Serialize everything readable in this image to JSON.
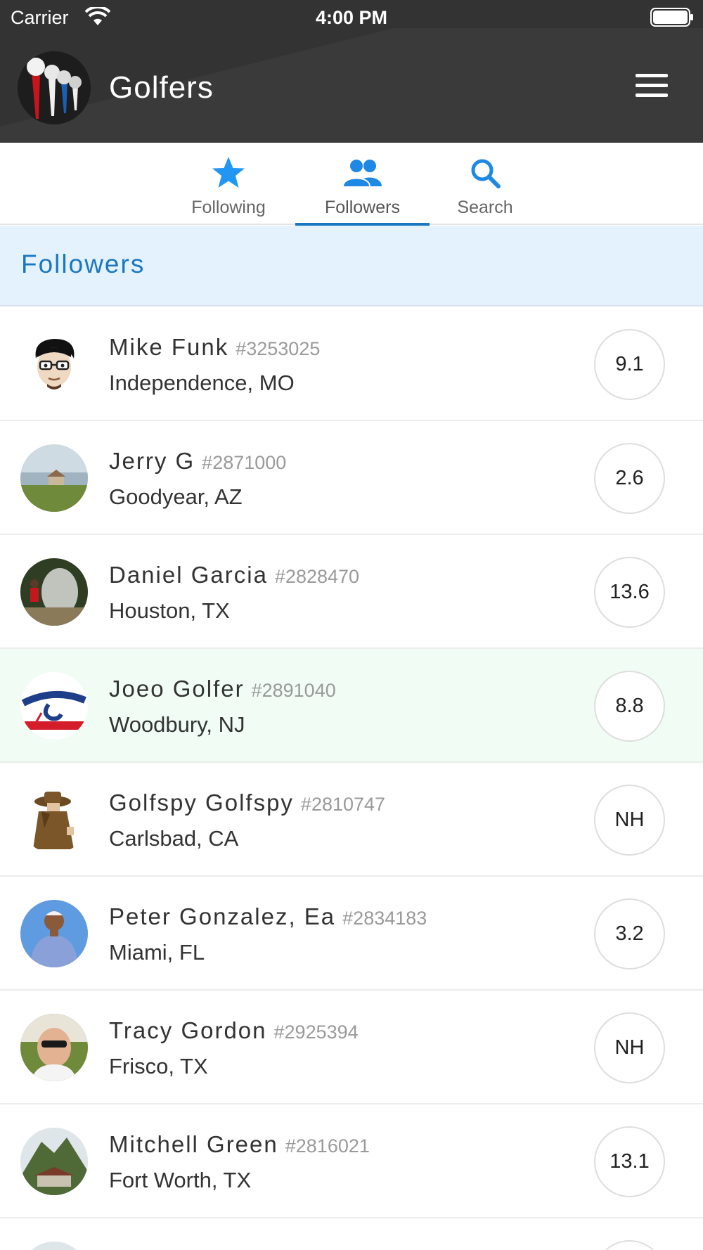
{
  "status_bar": {
    "carrier": "Carrier",
    "time": "4:00 PM"
  },
  "header": {
    "title": "Golfers"
  },
  "tabs": [
    {
      "label": "Following",
      "icon": "star-icon"
    },
    {
      "label": "Followers",
      "icon": "people-icon",
      "active": true
    },
    {
      "label": "Search",
      "icon": "search-icon"
    }
  ],
  "section": {
    "title": "Followers"
  },
  "followers": [
    {
      "name": "Mike Funk",
      "id": "#3253025",
      "location": "Independence, MO",
      "handicap": "9.1"
    },
    {
      "name": "Jerry G",
      "id": "#2871000",
      "location": "Goodyear, AZ",
      "handicap": "2.6"
    },
    {
      "name": "Daniel Garcia",
      "id": "#2828470",
      "location": "Houston, TX",
      "handicap": "13.6"
    },
    {
      "name": "Joeo Golfer",
      "id": "#2891040",
      "location": "Woodbury, NJ",
      "handicap": "8.8"
    },
    {
      "name": "Golfspy Golfspy",
      "id": "#2810747",
      "location": "Carlsbad, CA",
      "handicap": "NH"
    },
    {
      "name": "Peter Gonzalez, Ea",
      "id": "#2834183",
      "location": "Miami, FL",
      "handicap": "3.2"
    },
    {
      "name": "Tracy Gordon",
      "id": "#2925394",
      "location": "Frisco, TX",
      "handicap": "NH"
    },
    {
      "name": "Mitchell Green",
      "id": "#2816021",
      "location": "Fort Worth, TX",
      "handicap": "13.1"
    }
  ],
  "colors": {
    "accent": "#1a78c2",
    "header_bg": "#333333",
    "section_bg": "#e4f2fd",
    "highlight_row": "#f1fdf4"
  }
}
